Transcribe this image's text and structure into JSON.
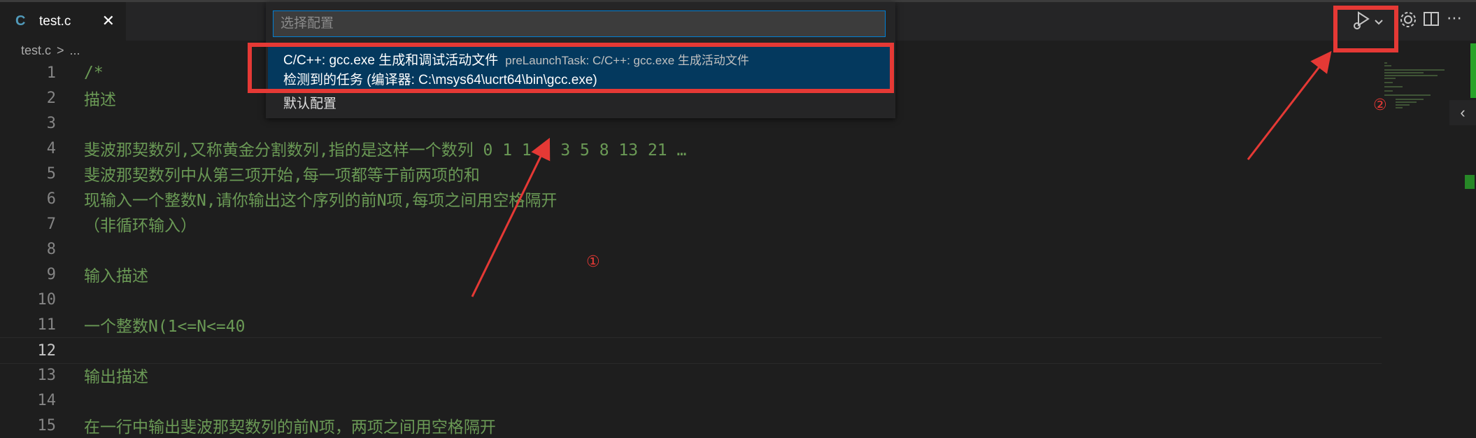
{
  "tab": {
    "icon": "C",
    "name": "test.c",
    "close": "✕"
  },
  "breadcrumb": {
    "file": "test.c",
    "sep": ">",
    "more": "..."
  },
  "quickpick": {
    "placeholder": "选择配置",
    "selected_label": "C/C++: gcc.exe 生成和调试活动文件",
    "selected_desc": "preLaunchTask: C/C++: gcc.exe 生成活动文件",
    "selected_detail": "检测到的任务 (编译器: C:\\msys64\\ucrt64\\bin\\gcc.exe)",
    "default_item": "默认配置"
  },
  "annotations": {
    "one": "①",
    "two": "②"
  },
  "lines": [
    {
      "n": "1",
      "t": "/*"
    },
    {
      "n": "2",
      "t": "描述"
    },
    {
      "n": "3",
      "t": ""
    },
    {
      "n": "4",
      "t": "斐波那契数列,又称黄金分割数列,指的是这样一个数列 0 1 1 2 3 5 8 13 21 …"
    },
    {
      "n": "5",
      "t": "斐波那契数列中从第三项开始,每一项都等于前两项的和"
    },
    {
      "n": "6",
      "t": "现输入一个整数N,请你输出这个序列的前N项,每项之间用空格隔开"
    },
    {
      "n": "7",
      "t": "（非循环输入）"
    },
    {
      "n": "8",
      "t": ""
    },
    {
      "n": "9",
      "t": "输入描述"
    },
    {
      "n": "10",
      "t": ""
    },
    {
      "n": "11",
      "t": "一个整数N(1<=N<=40"
    },
    {
      "n": "12",
      "t": ""
    },
    {
      "n": "13",
      "t": "输出描述"
    },
    {
      "n": "14",
      "t": ""
    },
    {
      "n": "15",
      "t": "在一行中输出斐波那契数列的前N项，两项之间用空格隔开"
    }
  ],
  "colors": {
    "comment": "#6a9955",
    "accent": "#007fd4",
    "annotation": "#e53935"
  },
  "icons": [
    "run-debug-icon",
    "chevron-down-icon",
    "gear-icon",
    "split-editor-icon",
    "more-actions-icon",
    "chevron-left-icon",
    "close-icon"
  ]
}
